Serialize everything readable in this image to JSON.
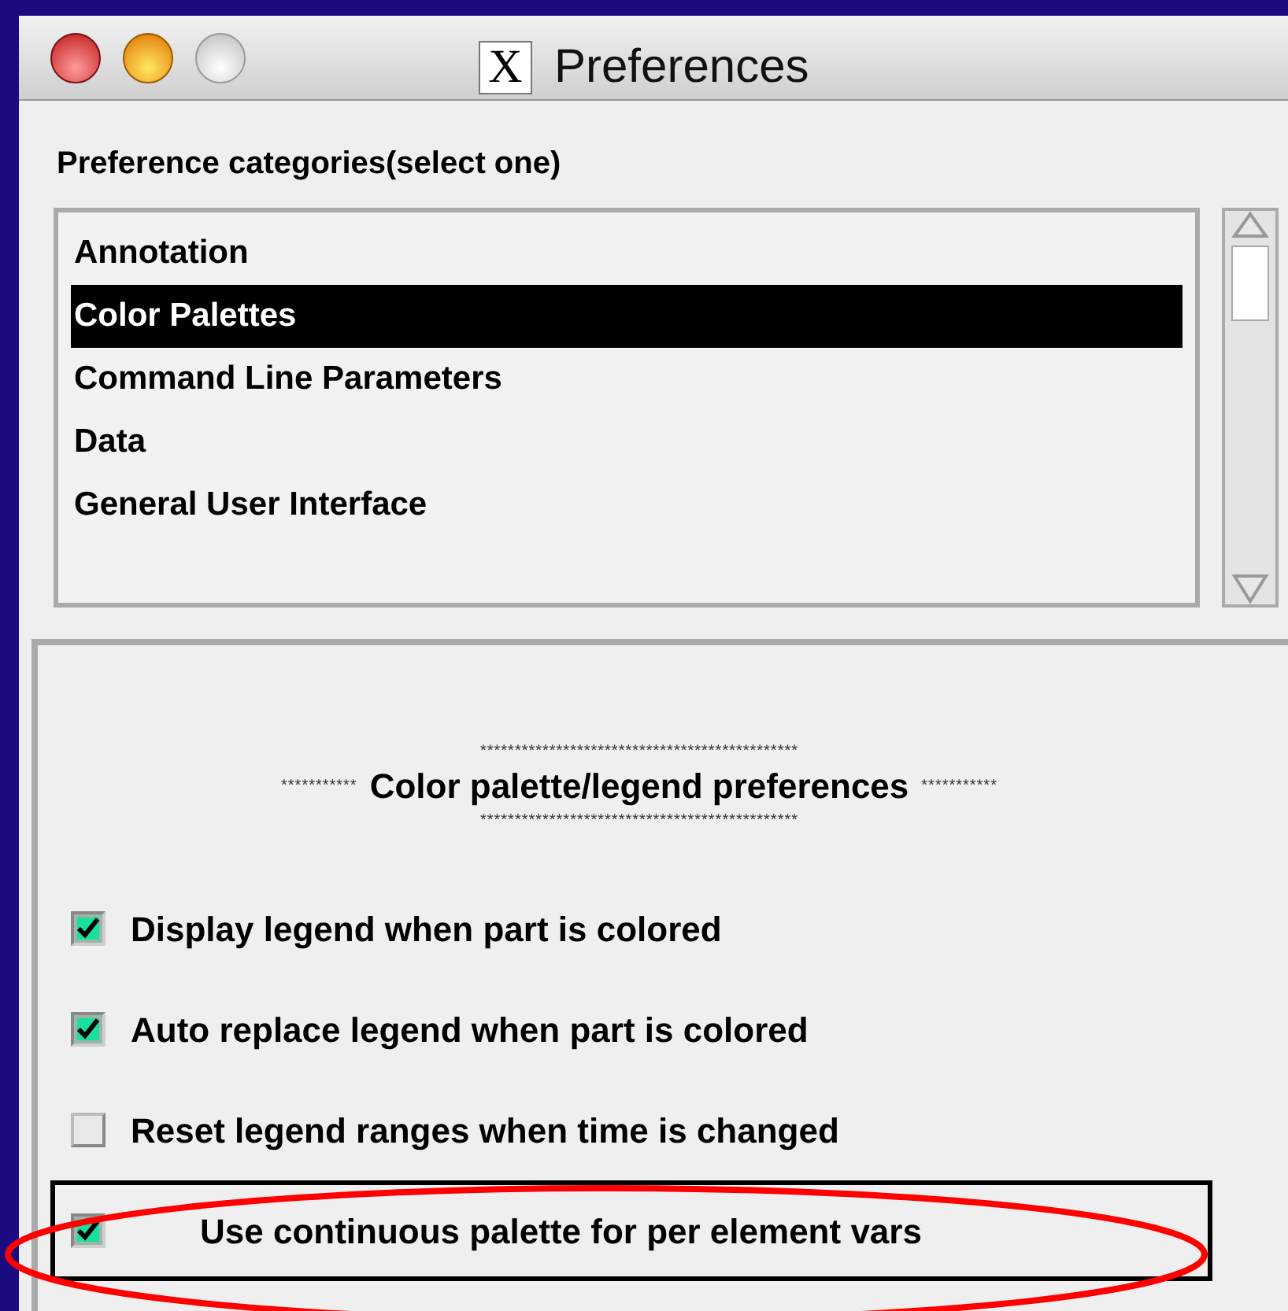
{
  "window": {
    "title": "Preferences",
    "app_badge": "X"
  },
  "categories": {
    "label": "Preference categories(select one)",
    "items": [
      {
        "label": "Annotation",
        "selected": false
      },
      {
        "label": "Color Palettes",
        "selected": true
      },
      {
        "label": "Command Line Parameters",
        "selected": false
      },
      {
        "label": "Data",
        "selected": false
      },
      {
        "label": "General User Interface",
        "selected": false
      }
    ]
  },
  "section": {
    "rule_top": "**********************************************",
    "side_left": "***********",
    "title": "Color palette/legend preferences",
    "side_right": "***********",
    "rule_bottom": "**********************************************"
  },
  "options": [
    {
      "label": "Display legend when part is colored",
      "checked": true,
      "highlighted": false
    },
    {
      "label": "Auto replace legend when part is colored",
      "checked": true,
      "highlighted": false
    },
    {
      "label": "Reset legend ranges when time is changed",
      "checked": false,
      "highlighted": false
    },
    {
      "label": "Use continuous palette for per element vars",
      "checked": true,
      "highlighted": true
    }
  ]
}
